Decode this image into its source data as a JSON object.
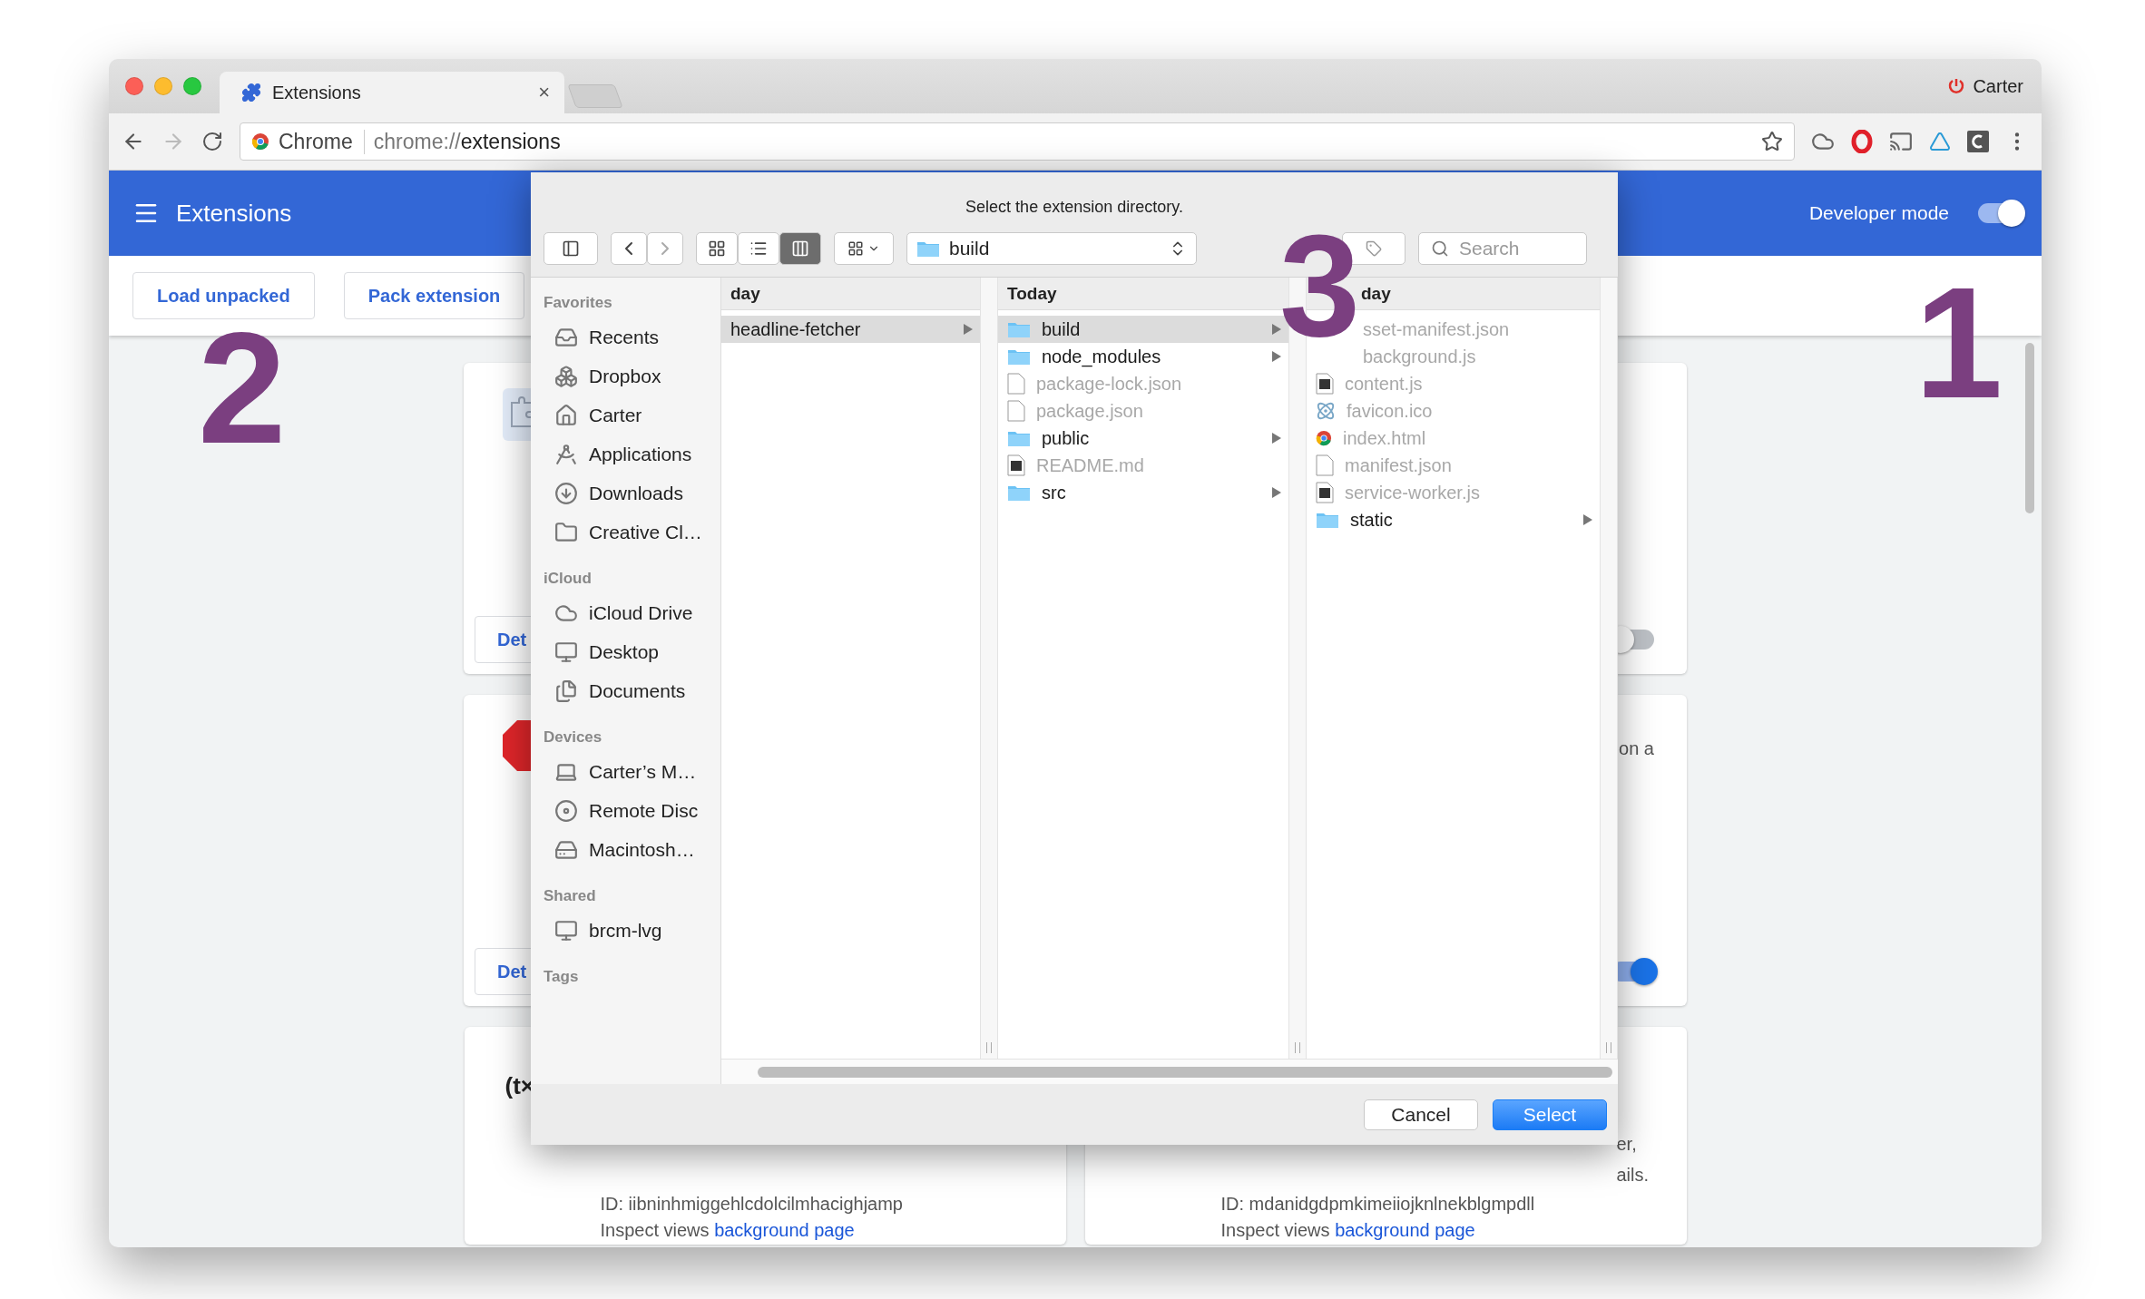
{
  "browser": {
    "tab": {
      "title": "Extensions",
      "close": "×"
    },
    "profile": "Carter",
    "address": {
      "site_label": "Chrome",
      "url_prefix": "chrome://",
      "url_path": "extensions"
    }
  },
  "header": {
    "title": "Extensions",
    "developer_mode": {
      "label": "Developer mode",
      "on": true
    }
  },
  "actions": [
    "Load unpacked",
    "Pack extension"
  ],
  "cards": [
    {
      "kind": "puzzle",
      "details": "Det",
      "enabled": false
    },
    {
      "kind": "stop",
      "details": "Det",
      "description": "on a",
      "enabled": true
    }
  ],
  "bottom_cards": [
    {
      "heading": "(t×",
      "id": "ID: iibninhmiggehlcdolcilmhacighjamp",
      "inspect": "Inspect views",
      "link": "background page"
    },
    {
      "description_lines": [
        "er,",
        "ails."
      ],
      "id": "ID: mdanidgdpmkimeiiojknlnekblgmpdll",
      "inspect": "Inspect views",
      "link": "background page"
    }
  ],
  "dialog": {
    "title": "Select the extension directory.",
    "path": "build",
    "search_placeholder": "Search",
    "view_modes": [
      {
        "selected": false
      },
      {
        "selected": false
      },
      {
        "selected": true
      }
    ],
    "sidebar": [
      {
        "heading": "Favorites",
        "items": [
          "Recents",
          "Dropbox",
          "Carter",
          "Applications",
          "Downloads",
          "Creative Cl…"
        ]
      },
      {
        "heading": "iCloud",
        "items": [
          "iCloud Drive",
          "Desktop",
          "Documents"
        ]
      },
      {
        "heading": "Devices",
        "items": [
          "Carter’s M…",
          "Remote Disc",
          "Macintosh…"
        ]
      },
      {
        "heading": "Shared",
        "items": [
          "brcm-lvg"
        ]
      },
      {
        "heading": "Tags"
      }
    ],
    "columns": [
      {
        "header": "day",
        "items": [
          {
            "name": "headline-fetcher",
            "kind": "hidden",
            "selected": true,
            "disabled": false,
            "expandable": true
          }
        ]
      },
      {
        "header": "Today",
        "items": [
          {
            "name": "build",
            "kind": "folder",
            "selected": true,
            "disabled": false,
            "expandable": true
          },
          {
            "name": "node_modules",
            "kind": "folder",
            "selected": false,
            "disabled": false,
            "expandable": true
          },
          {
            "name": "package-lock.json",
            "kind": "blank",
            "selected": false,
            "disabled": true,
            "expandable": false
          },
          {
            "name": "package.json",
            "kind": "blank",
            "selected": false,
            "disabled": true,
            "expandable": false
          },
          {
            "name": "public",
            "kind": "folder",
            "selected": false,
            "disabled": false,
            "expandable": true
          },
          {
            "name": "README.md",
            "kind": "script",
            "selected": false,
            "disabled": true,
            "expandable": false
          },
          {
            "name": "src",
            "kind": "folder",
            "selected": false,
            "disabled": false,
            "expandable": true
          }
        ]
      },
      {
        "header": "day",
        "items": [
          {
            "name": "sset-manifest.json",
            "kind": "covered",
            "selected": false,
            "disabled": true,
            "expandable": false
          },
          {
            "name": "background.js",
            "kind": "covered",
            "selected": false,
            "disabled": true,
            "expandable": false
          },
          {
            "name": "content.js",
            "kind": "script",
            "selected": false,
            "disabled": true,
            "expandable": false
          },
          {
            "name": "favicon.ico",
            "kind": "atom",
            "selected": false,
            "disabled": true,
            "expandable": false
          },
          {
            "name": "index.html",
            "kind": "web",
            "selected": false,
            "disabled": true,
            "expandable": false
          },
          {
            "name": "manifest.json",
            "kind": "blank",
            "selected": false,
            "disabled": true,
            "expandable": false
          },
          {
            "name": "service-worker.js",
            "kind": "script",
            "selected": false,
            "disabled": true,
            "expandable": false
          },
          {
            "name": "static",
            "kind": "folder",
            "selected": false,
            "disabled": false,
            "expandable": true
          }
        ]
      }
    ],
    "buttons": [
      "Cancel",
      "Select"
    ]
  },
  "annotations": [
    "1",
    "2",
    "3"
  ]
}
